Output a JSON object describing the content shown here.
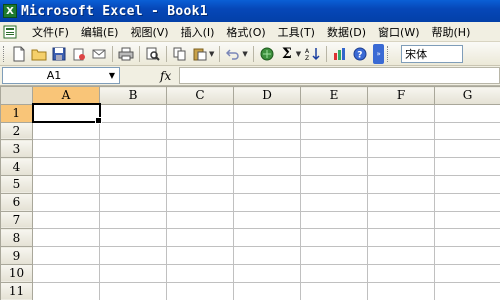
{
  "window": {
    "title": "Microsoft Excel - Book1",
    "app_icon": "excel-icon"
  },
  "menu": {
    "items": [
      {
        "label": "文件(F)"
      },
      {
        "label": "编辑(E)"
      },
      {
        "label": "视图(V)"
      },
      {
        "label": "插入(I)"
      },
      {
        "label": "格式(O)"
      },
      {
        "label": "工具(T)"
      },
      {
        "label": "数据(D)"
      },
      {
        "label": "窗口(W)"
      },
      {
        "label": "帮助(H)"
      }
    ]
  },
  "toolbar": {
    "sum_label": "Σ",
    "font_name": "宋体"
  },
  "formula_bar": {
    "name_box": "A1",
    "fx_label": "fx",
    "formula_value": ""
  },
  "sheet": {
    "columns": [
      "A",
      "B",
      "C",
      "D",
      "E",
      "F",
      "G"
    ],
    "rows": [
      "1",
      "2",
      "3",
      "4",
      "5",
      "6",
      "7",
      "8",
      "9",
      "10",
      "11"
    ],
    "active_cell": "A1",
    "active_highlight": "#f9c578"
  }
}
